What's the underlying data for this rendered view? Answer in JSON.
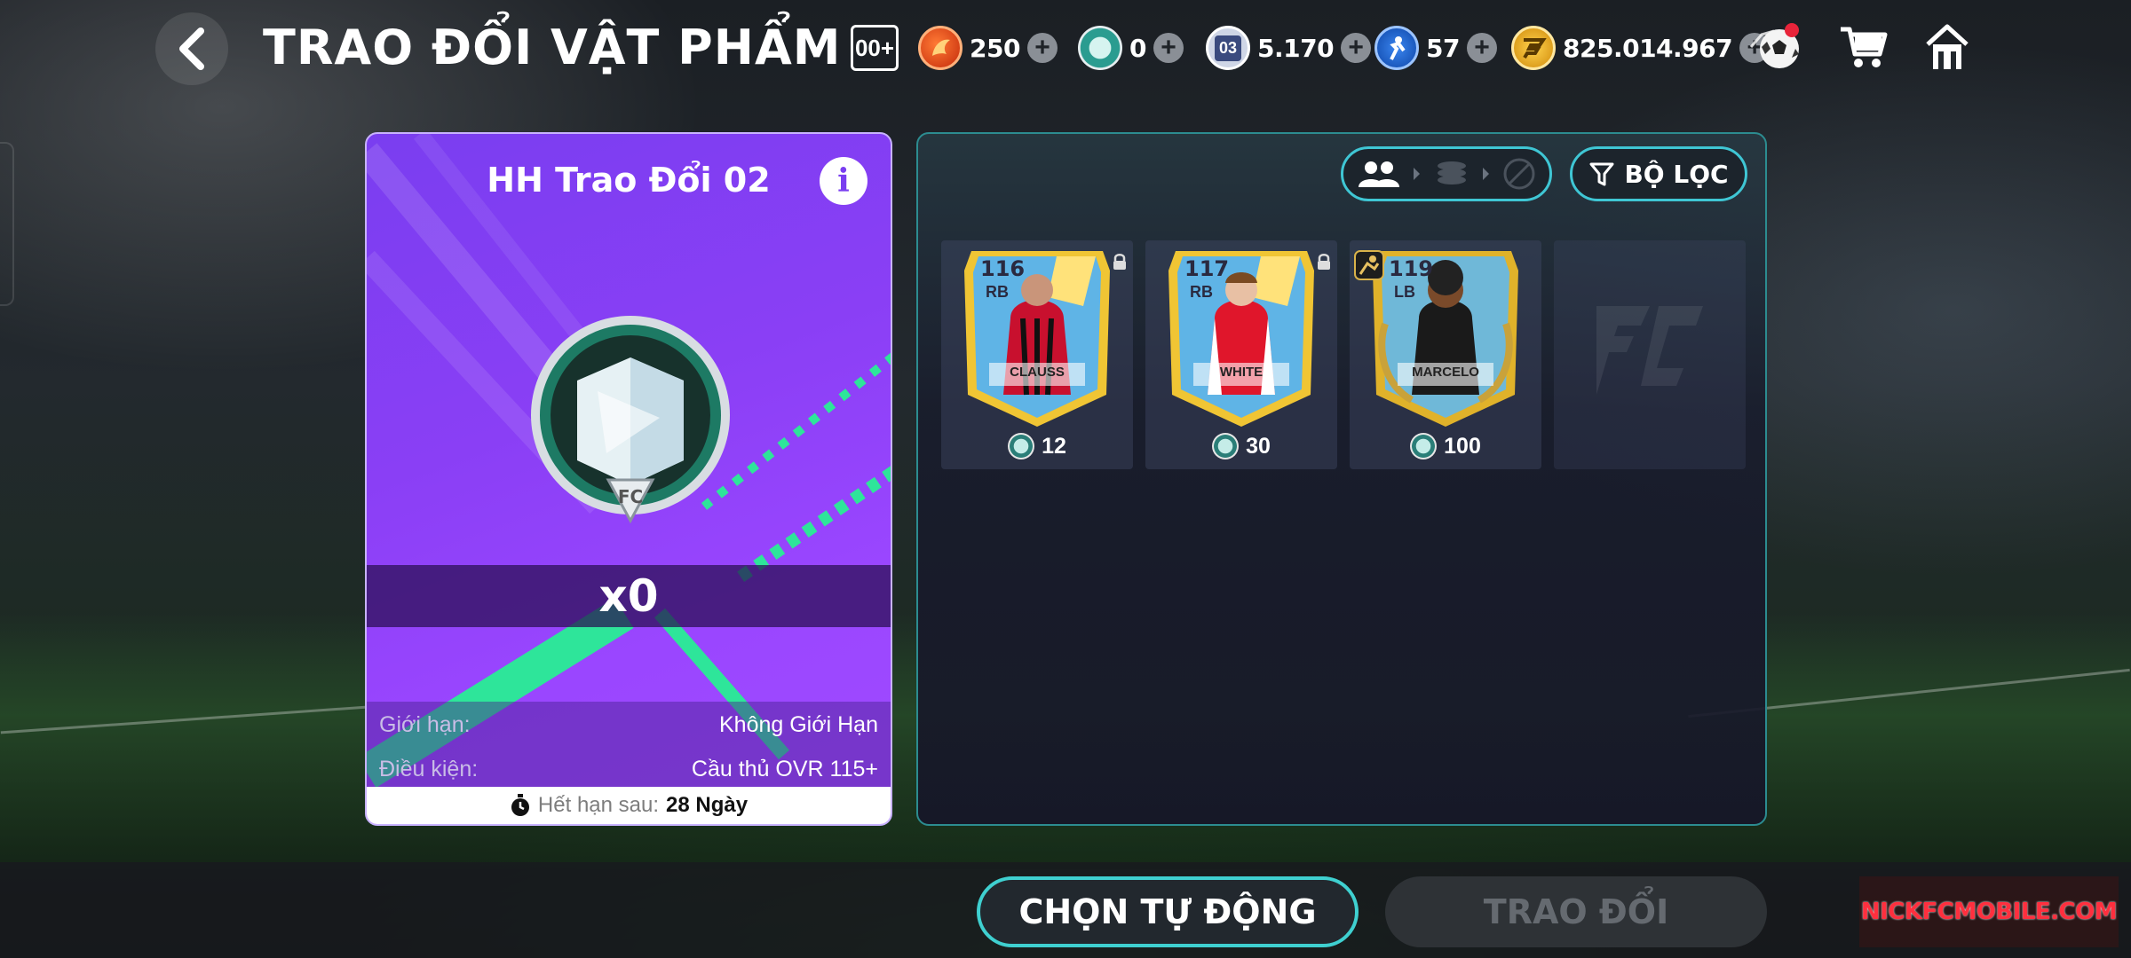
{
  "header": {
    "title": "TRAO ĐỔI VẬT PHẨM",
    "ovr_badge": "00+",
    "currencies": [
      {
        "icon": "fc-points-coin-icon",
        "value": "250",
        "color": "#e84a1a"
      },
      {
        "icon": "exchange-token-icon",
        "value": "0",
        "color": "#2a9c90"
      },
      {
        "icon": "level-03-icon",
        "label": "03",
        "value": "5.170",
        "color": "#3b4b7e"
      },
      {
        "icon": "player-skill-icon",
        "value": "57",
        "color": "#1f6ed8"
      },
      {
        "icon": "fc-coin-icon",
        "value": "825.014.967",
        "color": "#f2b21b"
      }
    ]
  },
  "item": {
    "title": "HH Trao Đổi 02",
    "quantity": "x0",
    "limit_label": "Giới hạn:",
    "limit_value": "Không Giới Hạn",
    "condition_label": "Điều kiện:",
    "condition_value": "Cầu thủ OVR 115+",
    "expire_label": "Hết hạn sau:",
    "expire_value": "28 Ngày"
  },
  "filter": {
    "label": "BỘ LỌC"
  },
  "players": [
    {
      "ovr": "116",
      "pos": "RB",
      "name": "CLAUSS",
      "price": "12",
      "locked": true,
      "kit": "nice"
    },
    {
      "ovr": "117",
      "pos": "RB",
      "name": "WHITE",
      "price": "30",
      "locked": true,
      "kit": "arsenal"
    },
    {
      "ovr": "119",
      "pos": "LB",
      "name": "MARCELO",
      "price": "100",
      "locked": false,
      "kit": "black"
    }
  ],
  "buttons": {
    "auto_select": "CHỌN TỰ ĐỘNG",
    "trade": "TRAO ĐỔI"
  },
  "watermark": "NICKFCMOBILE.COM"
}
